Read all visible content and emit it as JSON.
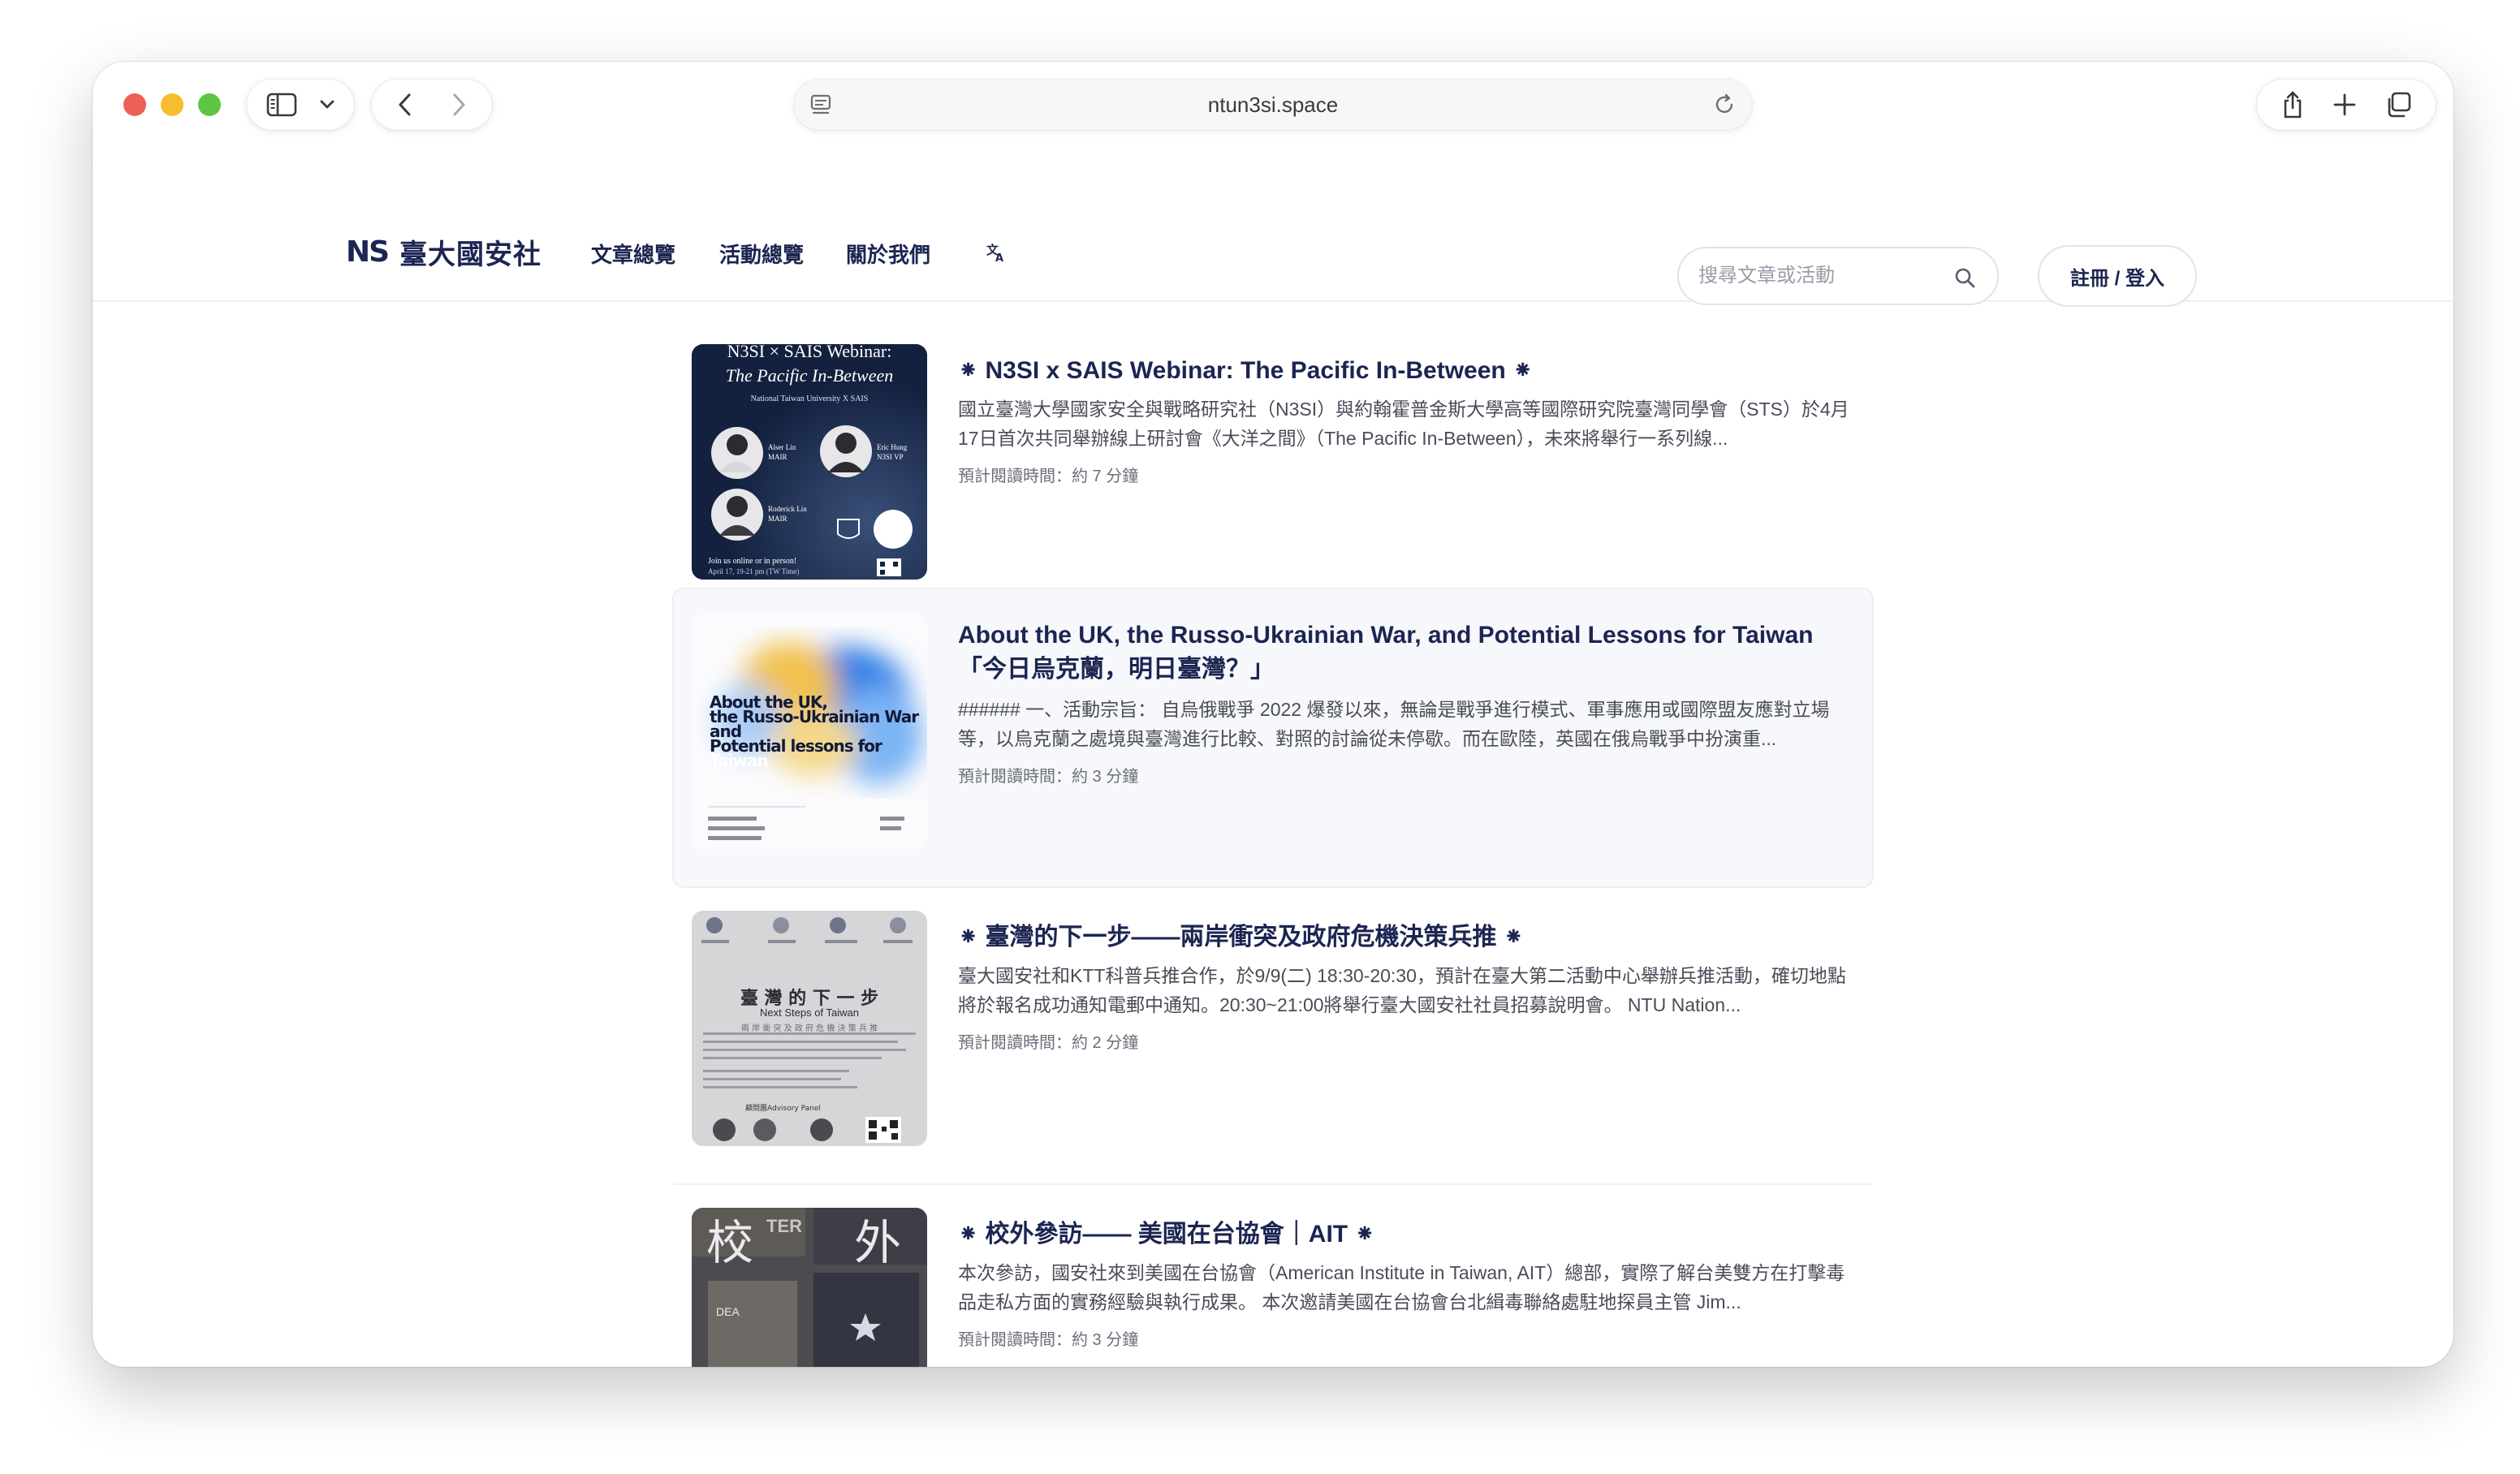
{
  "browser": {
    "url": "ntun3si.space"
  },
  "site": {
    "logo_mark": "NS",
    "logo_text": "臺大國安社",
    "nav": [
      "文章總覽",
      "活動總覽",
      "關於我們"
    ],
    "lang_icon": "translate-icon",
    "search_placeholder": "搜尋文章或活動",
    "login_label": "註冊 / 登入"
  },
  "articles": [
    {
      "title": "⁕ N3SI x SAIS Webinar: The Pacific In-Between ⁕",
      "desc": "國立臺灣大學國家安全與戰略研究社（N3SI）與約翰霍普金斯大學高等國際研究院臺灣同學會（STS）於4月17日首次共同舉辦線上研討會《大洋之間》（The Pacific In-Between），未來將舉行一系列線...",
      "read": "預計閱讀時間：約 7 分鐘",
      "thumb": {
        "line1": "N3SI × SAIS Webinar:",
        "line2": "The Pacific In-Between",
        "line3": "National Taiwan University X SAIS",
        "p1": "Alser Lin",
        "p1b": "MAIR",
        "p2": "Eric Hung",
        "p2b": "N3SI VP",
        "p3": "Roderick Lin",
        "p3b": "MAIR",
        "foot": "Join us online or in person!",
        "foot2": "April 17, 19-21 pm (TW Time)"
      }
    },
    {
      "title": "About the UK, the Russo-Ukrainian War, and Potential Lessons for Taiwan「今日烏克蘭，明日臺灣？」",
      "desc": "###### 一、活動宗旨： 自烏俄戰爭 2022 爆發以來，無論是戰爭進行模式、軍事應用或國際盟友應對立場等，以烏克蘭之處境與臺灣進行比較、對照的討論從未停歇。而在歐陸，英國在俄烏戰爭中扮演重...",
      "read": "預計閱讀時間：約 3 分鐘",
      "thumb": {
        "line1": "About the UK,",
        "line2": "the Russo-Ukrainian War",
        "line3": "and",
        "line4": "Potential lessons for",
        "line5": "Taiwan"
      }
    },
    {
      "title": "⁕ 臺灣的下一步——兩岸衝突及政府危機決策兵推 ⁕",
      "desc": "臺大國安社和KTT科普兵推合作，於9/9(二) 18:30-20:30，預計在臺大第二活動中心舉辦兵推活動，確切地點將於報名成功通知電郵中通知。20:30~21:00將舉行臺大國安社社員招募說明會。 NTU Nation...",
      "read": "預計閱讀時間：約 2 分鐘",
      "thumb": {
        "line1": "臺 灣 的 下 一 步",
        "line2": "Next Steps of Taiwan",
        "line3": "兩 岸 衝 突 及 政 府 危 機 決 策 兵 推",
        "panel": "顧問團Advisory Panel"
      }
    },
    {
      "title": "⁕ 校外參訪—— 美國在台協會｜AIT ⁕",
      "desc": "本次參訪，國安社來到美國在台協會（American Institute in Taiwan, AIT）總部，實際了解台美雙方在打擊毒品走私方面的實務經驗與執行成果。 本次邀請美國在台協會台北緝毒聯絡處駐地探員主管 Jim...",
      "read": "預計閱讀時間：約 3 分鐘",
      "thumb": {
        "char1": "校",
        "char2": "外",
        "sign": "TER",
        "sign2": "DEA"
      }
    }
  ]
}
